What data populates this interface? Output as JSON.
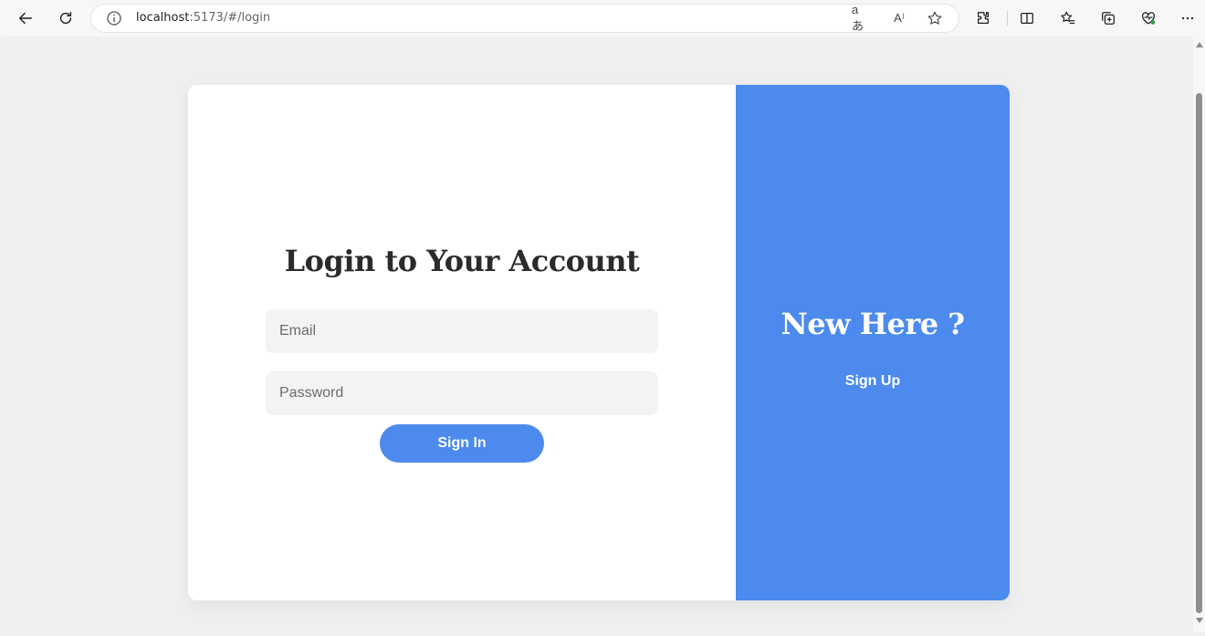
{
  "browser": {
    "url_host": "localhost",
    "url_path": ":5173/#/login",
    "translate_label": "aあ",
    "read_aloud_label": "A⁾"
  },
  "login": {
    "title": "Login to Your Account",
    "email_placeholder": "Email",
    "password_placeholder": "Password",
    "signin_label": "Sign In"
  },
  "signup_panel": {
    "heading": "New Here ?",
    "signup_label": "Sign Up"
  },
  "colors": {
    "accent": "#4c8aee",
    "page_background": "#efefef",
    "field_background": "#f3f3f3",
    "title_text": "#2b2b2b"
  }
}
